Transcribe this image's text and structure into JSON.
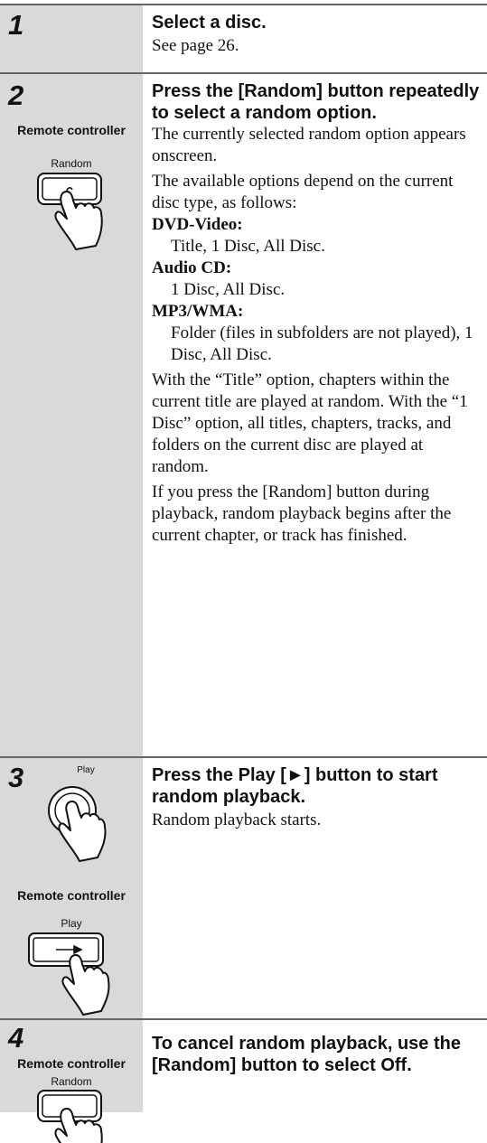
{
  "remote_label": "Remote controller",
  "step1": {
    "number": "1",
    "heading": "Select a disc.",
    "text": "See page 26."
  },
  "step2": {
    "number": "2",
    "heading": "Press the [Random] button repeatedly to select a random option.",
    "button_label": "Random",
    "para1": "The currently selected random option appears onscreen.",
    "para2": "The available options depend on the current disc type, as follows:",
    "dvd_label": "DVD-Video:",
    "dvd_value": "Title, 1 Disc, All Disc.",
    "cd_label": "Audio CD:",
    "cd_value": "1 Disc, All Disc.",
    "mp3_label": "MP3/WMA:",
    "mp3_value": "Folder (files in subfolders are not played), 1 Disc, All Disc.",
    "para3": "With the “Title” option, chapters within the current title are played at random. With the “1 Disc” option, all titles, chapters, tracks, and folders on the current disc are played at random.",
    "para4": "If you press the [Random] button during playback, random playback begins after the current chapter, or track has finished."
  },
  "step3": {
    "number": "3",
    "heading": "Press the Play [►] button to start random playback.",
    "unit_button_label": "Play",
    "remote_button_label": "Play",
    "remote_button_symbol": "►",
    "text": "Random playback starts."
  },
  "step4": {
    "number": "4",
    "heading": "To cancel random playback, use the [Random] button to select Off.",
    "button_label": "Random"
  }
}
